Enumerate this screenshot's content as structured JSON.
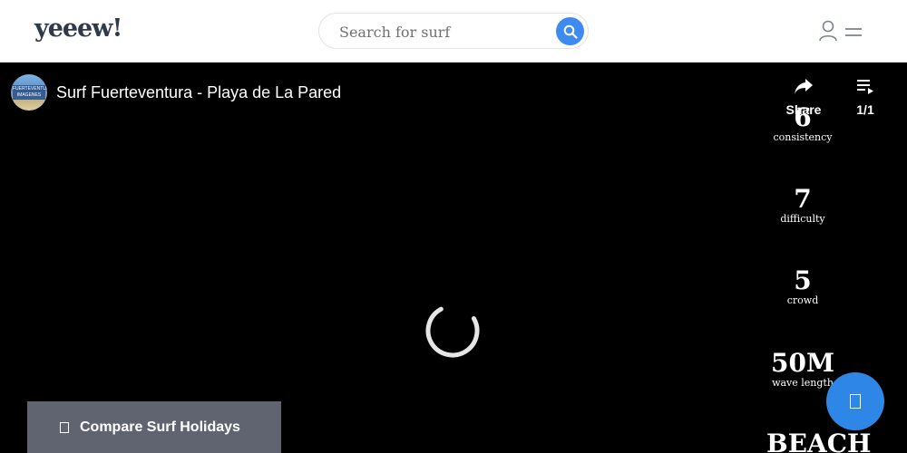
{
  "header": {
    "logo": "yeeew!",
    "search": {
      "placeholder": "Search for surf"
    }
  },
  "video": {
    "title": "Surf Fuerteventura - Playa de La Pared",
    "channel_badge": "FUERTEVENTURA IMAGENES",
    "share_label": "Share",
    "playlist_label": "1/1"
  },
  "stats": [
    {
      "value": "6",
      "label": "consistency"
    },
    {
      "value": "7",
      "label": "difficulty"
    },
    {
      "value": "5",
      "label": "crowd"
    },
    {
      "value": "50M",
      "label": "wave length"
    }
  ],
  "stat_partial": "BEACH",
  "compare_button": {
    "label": "Compare Surf Holidays"
  },
  "colors": {
    "accent": "#3d8bf0",
    "fab": "#2e87e6",
    "compare_bg": "#5f6470"
  },
  "icons": [
    "search-icon",
    "user-icon",
    "menu-icon",
    "share-icon",
    "playlist-icon",
    "loading-spinner",
    "chat-icon"
  ]
}
